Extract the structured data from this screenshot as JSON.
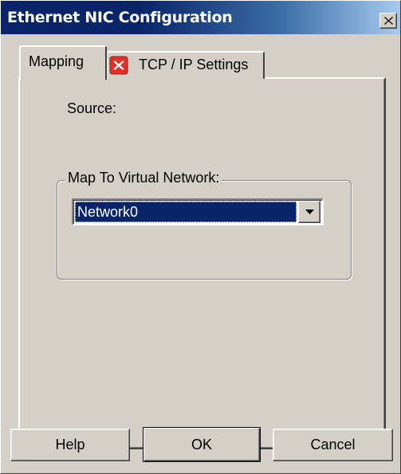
{
  "window": {
    "title": "Ethernet NIC Configuration",
    "close_icon": "close-icon"
  },
  "tabs": [
    {
      "label": "Mapping",
      "active": true
    },
    {
      "label": "TCP / IP Settings",
      "active": false,
      "icon": "error-icon"
    }
  ],
  "mapping": {
    "source_label": "Source:",
    "group_label": "Map To Virtual Network:",
    "network_select": {
      "selected": "Network0"
    }
  },
  "buttons": {
    "help": "Help",
    "ok": "OK",
    "cancel": "Cancel"
  },
  "colors": {
    "titlebar_start": "#0a246a",
    "titlebar_end": "#a6caf0",
    "face": "#d4d0c8",
    "selection": "#0a246a",
    "error_icon": "#e0302a"
  }
}
